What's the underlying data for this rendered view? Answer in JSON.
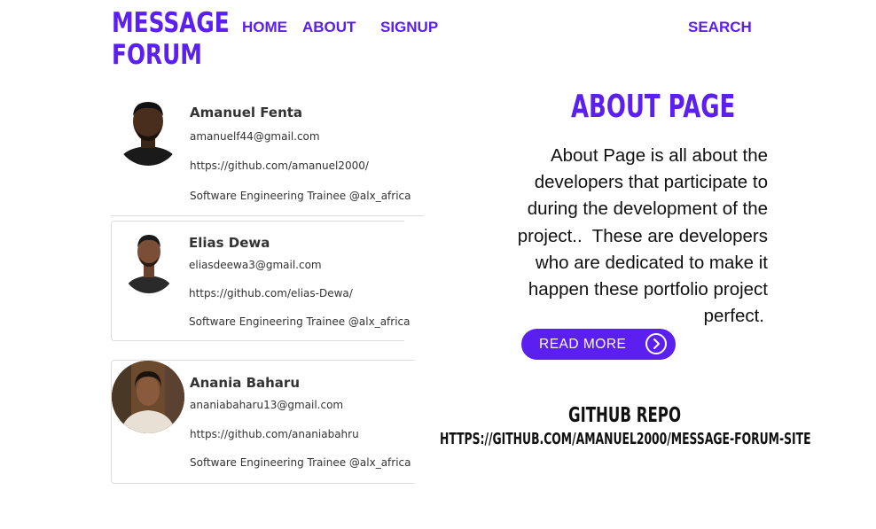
{
  "logo": {
    "line1": "MESSAGE",
    "line2": "FORUM"
  },
  "nav": {
    "home": "HOME",
    "about": "ABOUT",
    "signup": "SIGNUP",
    "search": "SEARCH"
  },
  "developers": [
    {
      "name": "Amanuel Fenta",
      "email": "amanuelf44@gmail.com",
      "github": "https://github.com/amanuel2000/",
      "role": "Software Engineering Trainee @alx_africa"
    },
    {
      "name": "Elias Dewa",
      "email": "eliasdeewa3@gmail.com",
      "github": "https://github.com/elias-Dewa/",
      "role": "Software Engineering Trainee @alx_africa"
    },
    {
      "name": "Anania Baharu",
      "email": "ananiabaharu13@gmail.com",
      "github": "https://github.com/ananiabahru",
      "role": "Software Engineering Trainee @alx_africa"
    }
  ],
  "about": {
    "title": "ABOUT PAGE",
    "lines": [
      "About Page is all about the",
      "developers that participate to",
      "during the development of the",
      "project..  These are developers",
      "who are dedicated to make it",
      "happen these portfolio project",
      "perfect."
    ],
    "button_label": "READ MORE"
  },
  "repo": {
    "title": "GITHUB REPO",
    "url": "HTTPS://GITHUB.COM/AMANUEL2000/MESSAGE-FORUM-SITE"
  },
  "colors": {
    "accent": "#5b1ff0"
  }
}
